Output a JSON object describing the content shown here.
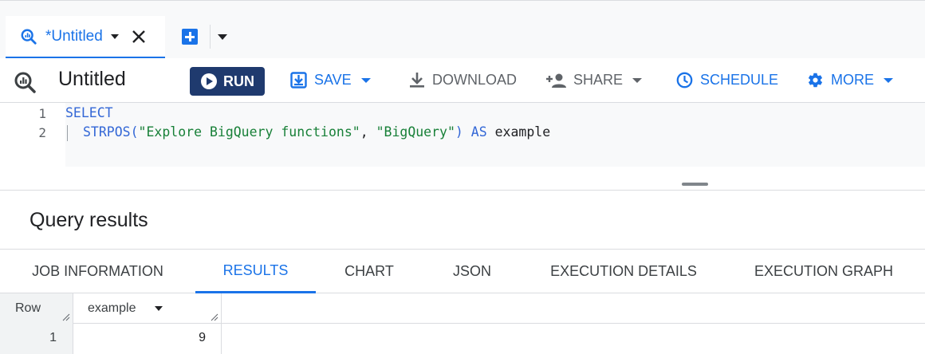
{
  "tab": {
    "title": "*Untitled"
  },
  "toolbar": {
    "doc_title": "Untitled",
    "run_label": "RUN",
    "save_label": "SAVE",
    "download_label": "DOWNLOAD",
    "share_label": "SHARE",
    "schedule_label": "SCHEDULE",
    "more_label": "MORE"
  },
  "editor": {
    "line_numbers": [
      "1",
      "2"
    ],
    "line1_kw": "SELECT",
    "line2": {
      "fn": "STRPOS(",
      "arg1": "\"Explore BigQuery functions\"",
      "sep": ", ",
      "arg2": "\"BigQuery\"",
      "close": ")",
      "as_kw": " AS ",
      "alias": "example"
    }
  },
  "results": {
    "title": "Query results",
    "tabs": [
      "JOB INFORMATION",
      "RESULTS",
      "CHART",
      "JSON",
      "EXECUTION DETAILS",
      "EXECUTION GRAPH"
    ],
    "active_tab": "RESULTS",
    "columns": [
      "Row",
      "example"
    ],
    "rows": [
      {
        "row": "1",
        "example": "9"
      }
    ]
  },
  "colors": {
    "accent": "#1a73e8",
    "run_button": "#1f3a6e",
    "keyword": "#3367d6",
    "string": "#188038"
  },
  "icons": {
    "tab_icon": "query-icon",
    "close": "close-icon",
    "new_tab": "add-box-icon",
    "save": "save-icon",
    "download": "download-icon",
    "share": "person-add-icon",
    "schedule": "clock-icon",
    "more": "gear-icon"
  }
}
